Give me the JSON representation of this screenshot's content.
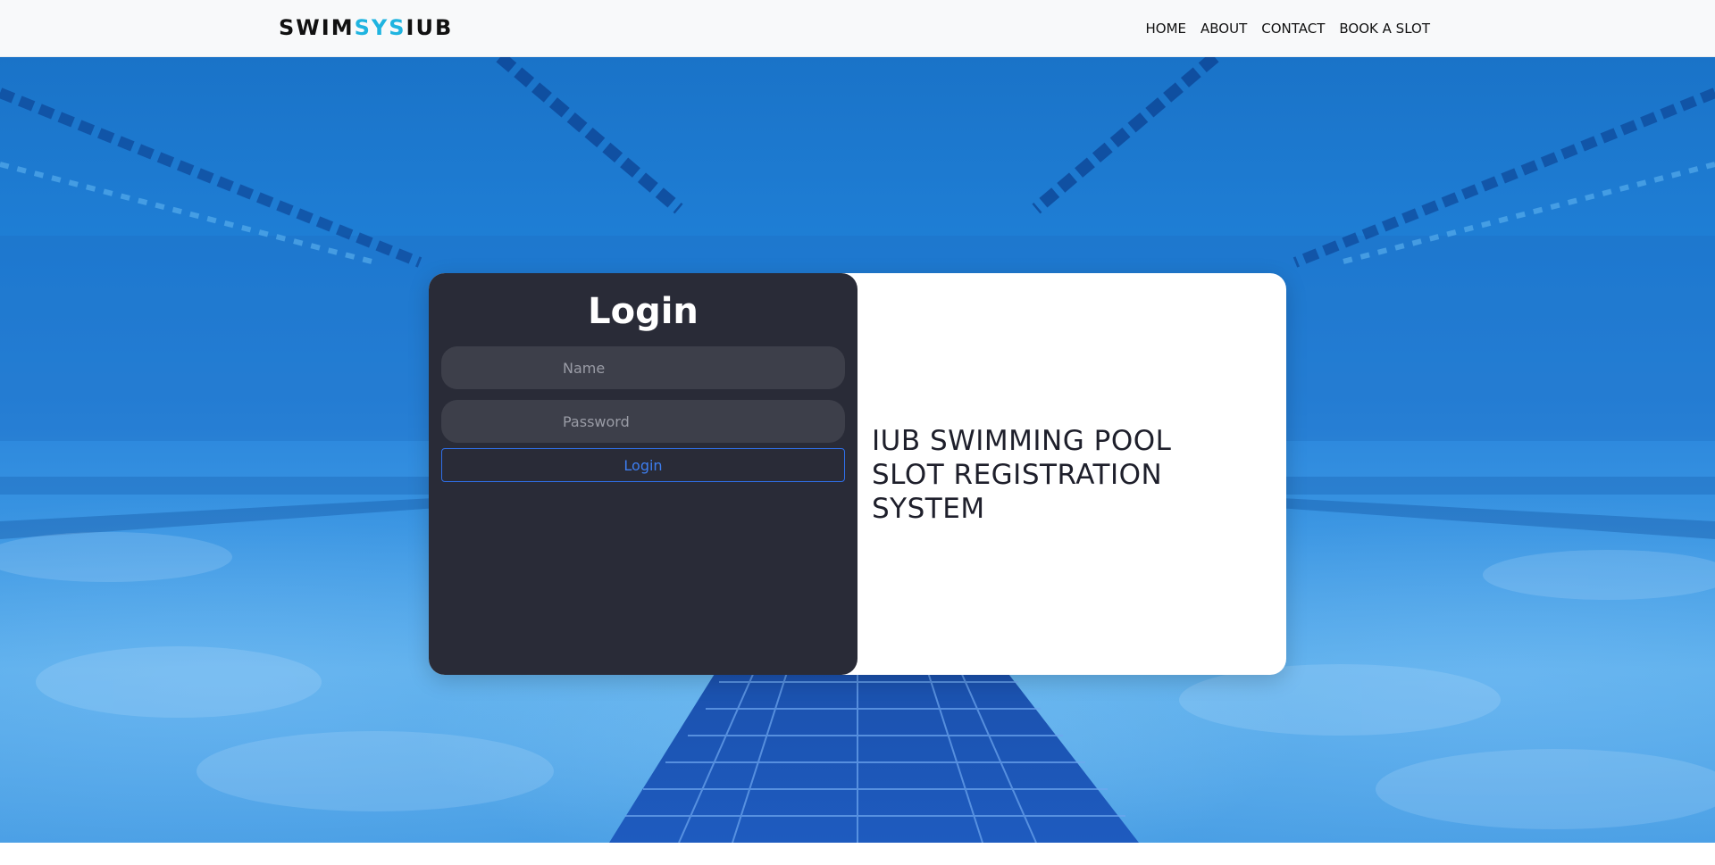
{
  "brand": {
    "part1": "SWIM",
    "part2": "SYS",
    "part3": "IUB"
  },
  "nav": {
    "items": [
      {
        "label": "HOME"
      },
      {
        "label": "ABOUT"
      },
      {
        "label": "CONTACT"
      },
      {
        "label": "BOOK A SLOT"
      }
    ]
  },
  "login": {
    "title": "Login",
    "name_placeholder": "Name",
    "password_placeholder": "Password",
    "button_label": "Login"
  },
  "info": {
    "lines": [
      "IUB SWIMMING POOL",
      "SLOT REGISTRATION",
      "SYSTEM"
    ]
  },
  "colors": {
    "brand_accent": "#1fb4e0",
    "login_panel_bg": "#292b37",
    "login_button_border": "#2f6fe8",
    "pool_blue": "#2a86dc"
  },
  "icons": {
    "hero_background": "swimming-pool-underwater-image"
  }
}
